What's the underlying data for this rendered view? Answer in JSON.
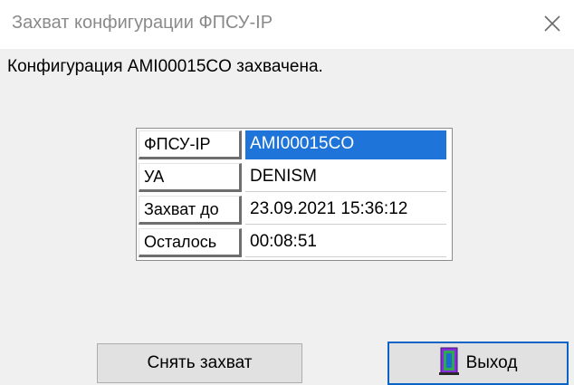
{
  "window": {
    "title": "Захват конфигурации ФПСУ-IP",
    "close_icon": "close-icon"
  },
  "message": "Конфигурация AMI00015CO захвачена.",
  "table": {
    "rows": [
      {
        "label": "ФПСУ-IP",
        "value": "AMI00015CO",
        "selected": true
      },
      {
        "label": "УА",
        "value": "DENISM",
        "selected": false
      },
      {
        "label": "Захват до",
        "value": "23.09.2021 15:36:12",
        "selected": false
      },
      {
        "label": "Осталось",
        "value": "00:08:51",
        "selected": false
      }
    ]
  },
  "buttons": {
    "release_label": "Снять захват",
    "exit_label": "Выход",
    "exit_icon": "exit-door-icon"
  },
  "colors": {
    "selection": "#1e74d8",
    "focus_border": "#0a64c8",
    "dialog_bg": "#f0f0f0"
  }
}
